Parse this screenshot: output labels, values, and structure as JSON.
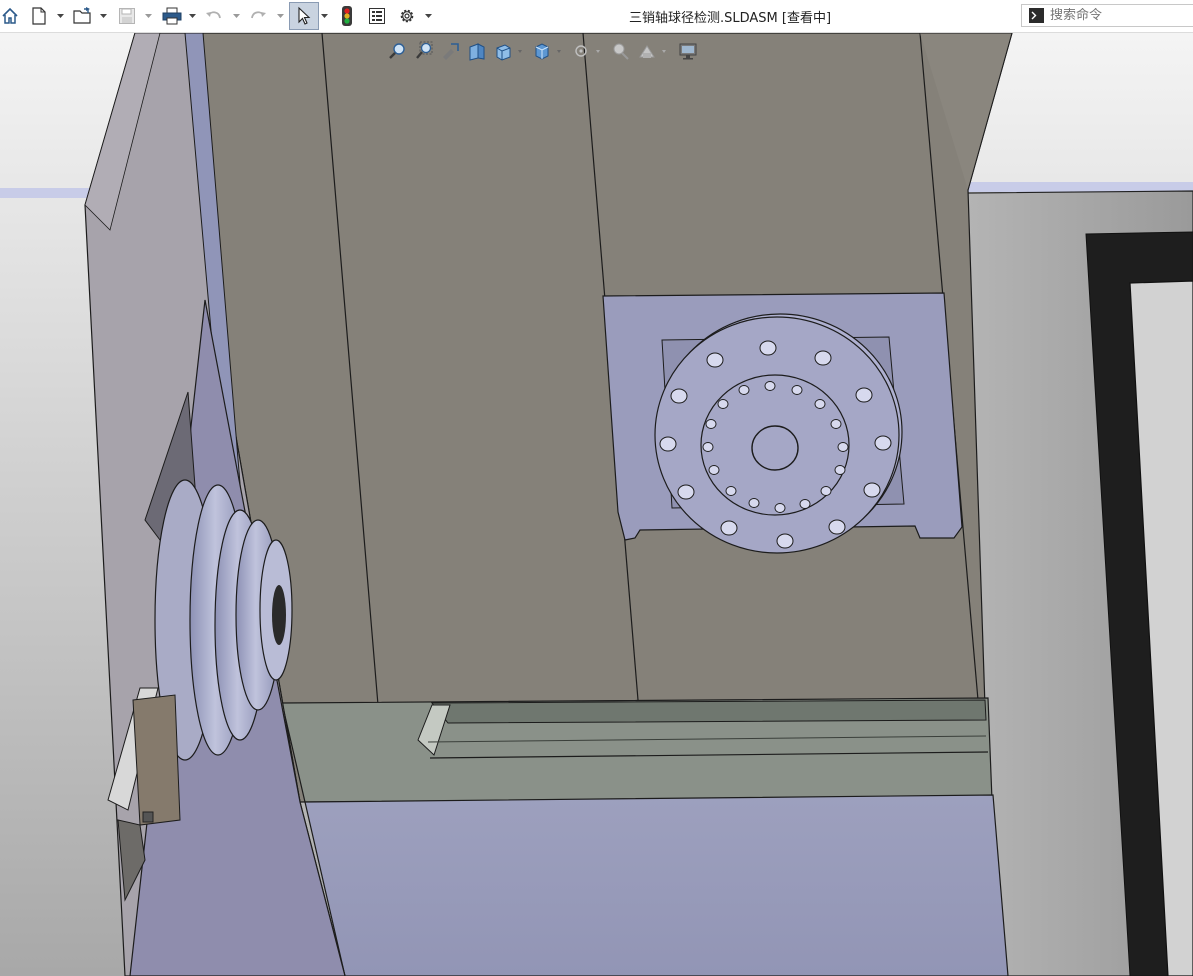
{
  "window": {
    "document_title": "三销轴球径检测.SLDASM [查看中]"
  },
  "toolbar": {
    "buttons": [
      {
        "id": "home",
        "icon": "home-icon"
      },
      {
        "id": "new",
        "icon": "new-document-icon",
        "dropdown": true
      },
      {
        "id": "open",
        "icon": "open-folder-icon",
        "dropdown": true
      },
      {
        "id": "save",
        "icon": "save-icon",
        "dropdown": true,
        "disabled": true
      },
      {
        "id": "print",
        "icon": "print-icon",
        "dropdown": true
      },
      {
        "id": "undo",
        "icon": "undo-icon",
        "dropdown": true,
        "disabled": true
      },
      {
        "id": "redo",
        "icon": "redo-icon",
        "dropdown": true,
        "disabled": true
      },
      {
        "id": "select",
        "icon": "select-pointer-icon",
        "dropdown": true,
        "active": true
      },
      {
        "id": "rebuild",
        "icon": "traffic-light-icon"
      },
      {
        "id": "file-properties",
        "icon": "file-properties-icon"
      },
      {
        "id": "options",
        "icon": "gear-icon",
        "dropdown": true
      }
    ]
  },
  "search": {
    "placeholder": "搜索命令",
    "icon": "command-prompt-icon"
  },
  "heads_up_toolbar": {
    "buttons": [
      {
        "id": "zoom-to-fit",
        "icon": "zoom-to-fit-icon"
      },
      {
        "id": "zoom-to-area",
        "icon": "zoom-to-area-icon"
      },
      {
        "id": "previous-view",
        "icon": "previous-view-icon"
      },
      {
        "id": "section-view",
        "icon": "section-view-icon"
      },
      {
        "id": "view-orientation",
        "icon": "view-orientation-icon"
      },
      {
        "id": "display-style",
        "icon": "display-style-icon"
      },
      {
        "id": "hide-show-items",
        "icon": "hide-show-icon"
      },
      {
        "id": "edit-appearance",
        "icon": "edit-appearance-icon"
      },
      {
        "id": "apply-scene",
        "icon": "apply-scene-icon"
      },
      {
        "id": "view-settings",
        "icon": "monitor-icon"
      }
    ]
  },
  "colors": {
    "toolbar_bg": "#ffffff",
    "active_tool_bg": "#c9d3e0",
    "part_lavender": "#9a9cbc",
    "housing_gray": "#858179",
    "base_gray": "#8a9189",
    "cabinet_gray": "#a6a6a6"
  }
}
